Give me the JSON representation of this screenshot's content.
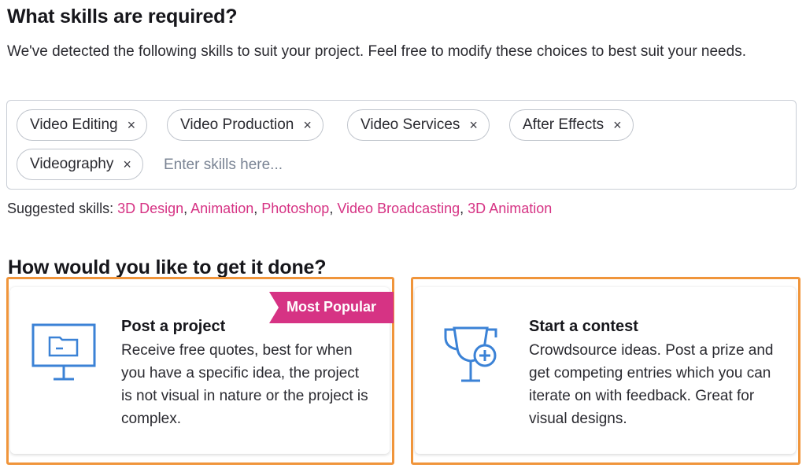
{
  "skills_section": {
    "heading": "What skills are required?",
    "description": "We've detected the following skills to suit your project. Feel free to modify these choices to best suit your needs.",
    "chips": [
      {
        "label": "Video Editing",
        "remove": "×"
      },
      {
        "label": "Video Production",
        "remove": "×"
      },
      {
        "label": "Video Services",
        "remove": "×"
      },
      {
        "label": "After Effects",
        "remove": "×"
      },
      {
        "label": "Videography",
        "remove": "×"
      }
    ],
    "input_placeholder": "Enter skills here...",
    "suggested_label": "Suggested skills:",
    "suggested": [
      "3D Design",
      "Animation",
      "Photoshop",
      "Video Broadcasting",
      "3D Animation"
    ],
    "separator": ","
  },
  "how_section": {
    "heading": "How would you like to get it done?",
    "options": [
      {
        "title": "Post a project",
        "description": "Receive free quotes, best for when you have a specific idea, the project is not visual in nature or the project is complex.",
        "badge": "Most Popular",
        "icon": "monitor-folder-icon"
      },
      {
        "title": "Start a contest",
        "description": "Crowdsource ideas. Post a prize and get competing entries which you can iterate on with feedback. Great for visual designs.",
        "icon": "trophy-plus-icon"
      }
    ]
  },
  "colors": {
    "accent_pink": "#d63384",
    "icon_blue": "#3b82d6",
    "highlight_orange": "#f0953b"
  }
}
